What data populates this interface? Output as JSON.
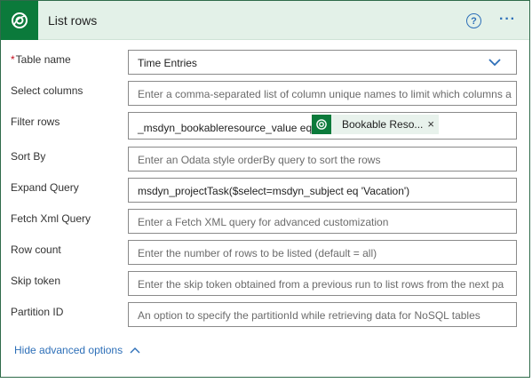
{
  "header": {
    "title": "List rows",
    "help_icon": "question-circle-icon",
    "more_icon": "ellipsis-icon",
    "help_glyph": "?",
    "more_glyph": "···",
    "brand_color": "#0b7a3b",
    "accent_color": "#2d6fb8"
  },
  "fields": {
    "table_name": {
      "required_mark": "*",
      "label": "Table name",
      "value": "Time Entries"
    },
    "select_columns": {
      "label": "Select columns",
      "placeholder": "Enter a comma-separated list of column unique names to limit which columns a"
    },
    "filter_rows": {
      "label": "Filter rows",
      "value": "_msdyn_bookableresource_value eq",
      "token_label": "Bookable Reso...",
      "token_close": "×"
    },
    "sort_by": {
      "label": "Sort By",
      "placeholder": "Enter an Odata style orderBy query to sort the rows"
    },
    "expand_query": {
      "label": "Expand Query",
      "value": "msdyn_projectTask($select=msdyn_subject eq 'Vacation')"
    },
    "fetch_xml": {
      "label": "Fetch Xml Query",
      "placeholder": "Enter a Fetch XML query for advanced customization"
    },
    "row_count": {
      "label": "Row count",
      "placeholder": "Enter the number of rows to be listed (default = all)"
    },
    "skip_token": {
      "label": "Skip token",
      "placeholder": "Enter the skip token obtained from a previous run to list rows from the next pa"
    },
    "partition_id": {
      "label": "Partition ID",
      "placeholder": "An option to specify the partitionId while retrieving data for NoSQL tables"
    }
  },
  "footer": {
    "hide_advanced": "Hide advanced options",
    "chevron": "chevron-up-icon"
  }
}
